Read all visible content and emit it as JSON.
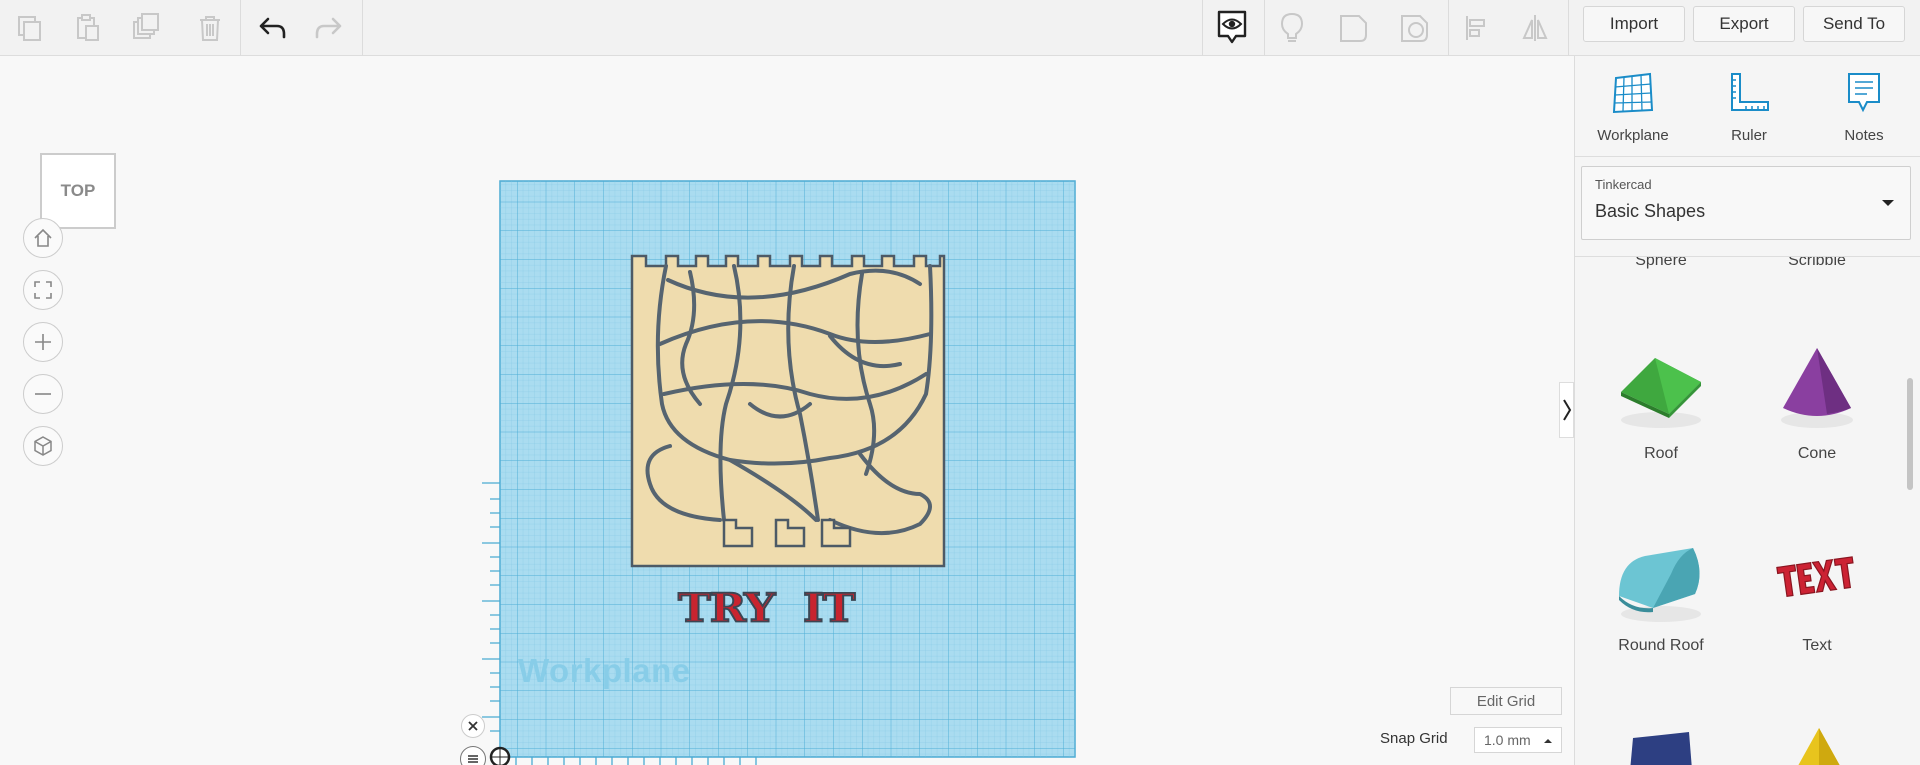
{
  "toolbar": {
    "import_label": "Import",
    "export_label": "Export",
    "send_to_label": "Send To"
  },
  "viewcube": {
    "label": "TOP"
  },
  "canvas": {
    "workplane_label": "Workplane",
    "design_text": "TRY  IT",
    "edit_grid_label": "Edit Grid",
    "snap_grid_label": "Snap Grid",
    "snap_grid_value": "1.0 mm"
  },
  "panel": {
    "tools": [
      {
        "label": "Workplane",
        "icon": "workplane-icon"
      },
      {
        "label": "Ruler",
        "icon": "ruler-icon"
      },
      {
        "label": "Notes",
        "icon": "notes-icon"
      }
    ],
    "library_source": "Tinkercad",
    "library_name": "Basic Shapes",
    "shapes": [
      {
        "label": "Sphere"
      },
      {
        "label": "Scribble"
      },
      {
        "label": "Roof",
        "color": "#3fa83f"
      },
      {
        "label": "Cone",
        "color": "#8a3fa0"
      },
      {
        "label": "Round Roof",
        "color": "#6cc5d3"
      },
      {
        "label": "Text",
        "color": "#cc2233"
      }
    ]
  },
  "colors": {
    "grid_blue": "#a8dcef",
    "accent_blue": "#1a8cc8",
    "design_tan": "#efdcae",
    "design_outline": "#4d5a66",
    "text_red": "#c8242f"
  }
}
